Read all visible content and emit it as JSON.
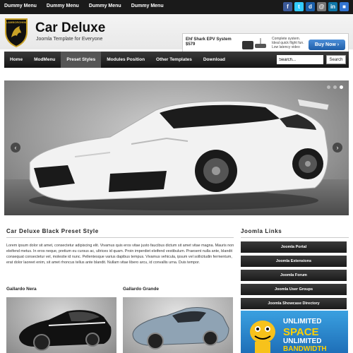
{
  "top_menu": [
    "Dummy Menu",
    "Dummy Menu",
    "Dummy Menu",
    "Dummy Menu"
  ],
  "social": [
    {
      "icon": "facebook-icon",
      "glyph": "f",
      "color": "#3b5998"
    },
    {
      "icon": "twitter-icon",
      "glyph": "t",
      "color": "#33ccff"
    },
    {
      "icon": "digg-icon",
      "glyph": "d",
      "color": "#1a5ea8"
    },
    {
      "icon": "email-icon",
      "glyph": "@",
      "color": "#777777"
    },
    {
      "icon": "linkedin-icon",
      "glyph": "in",
      "color": "#0e76a8"
    },
    {
      "icon": "delicious-icon",
      "glyph": "■",
      "color": "#3274d1"
    }
  ],
  "header": {
    "title": "Car Deluxe",
    "tagline": "Joomla Template for Everyone"
  },
  "ad": {
    "product": "Ehf Shark EPV System $579",
    "blurb": "Complete system. Ideal quick flight fun. Low latency video",
    "button": "Buy Now"
  },
  "nav": {
    "items": [
      "Home",
      "ModMenu",
      "Preset Styles",
      "Modules Position",
      "Other Templates",
      "Download"
    ],
    "active_index": 2
  },
  "search": {
    "value": "Search...",
    "button": "Search"
  },
  "main": {
    "title": "Car Deluxe Black Preset Style",
    "text": "Lorem ipsum dolor sit amet, consectetur adipiscing elit. Vivamus quis eros vitae justo faucibus dictum sit amet vitae magna. Mauris non eleifend metus. In eros neque, pretium eu cursus ac, ultrices id quam. Proin imperdiet eleifend vestibulum. Praesent nulla ante, blandit consequat consectetur vel, molestie id nunc. Pellentesque varius dapibus tempus. Vivamus vehicula, ipsum vel sollicitudin fermentum, erat dolor laoreet enim, sit amet rhoncus tellus ante blandit. Nullam vitae libero arcu, id convallis urna. Duis tempor.",
    "thumb1_title": "Gallardo Nera",
    "thumb2_title": "Gallardo Grande"
  },
  "sidebar": {
    "title": "Joomla Links",
    "links": [
      "Joomla Portal",
      "Joomla Extensions",
      "Joomla Forum",
      "Joomla User Groups",
      "Joomla Showcase Directory"
    ],
    "banner": {
      "line1": "UNLIMITED",
      "line2": "SPACE",
      "line3": "UNLIMITED",
      "line4": "BANDWIDTH"
    }
  },
  "colors": {
    "topbar": "#1a1a1a",
    "nav": "#222222",
    "accent_blue": "#1e6fb8"
  }
}
